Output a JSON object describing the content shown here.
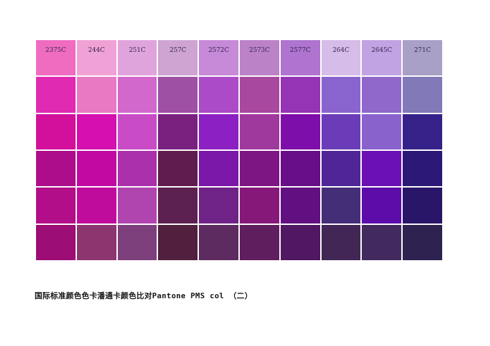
{
  "page": {
    "background_color": "#ffffff"
  },
  "caption": {
    "text": "国际标准颜色色卡潘通卡颜色比对Pantone PMS col （二）",
    "color": "#151515"
  },
  "chart_data": {
    "type": "heatmap",
    "title": "国际标准颜色色卡潘通卡颜色比对Pantone PMS col （二）",
    "columns": [
      "2375C",
      "244C",
      "251C",
      "257C",
      "2572C",
      "2573C",
      "2577C",
      "264C",
      "2645C",
      "271C"
    ],
    "rows": 6,
    "legend_position": "none",
    "grid_line_color": "#ffffff",
    "swatch_label_color": "#33234e",
    "cell_colors": [
      [
        "#ef6cc0",
        "#f0a2d6",
        "#e0a4dc",
        "#cfa4d2",
        "#c68ad8",
        "#bb82c8",
        "#ae74cf",
        "#d6bce8",
        "#c1a2e2",
        "#a8a0c6"
      ],
      [
        "#e02ab2",
        "#e87ac4",
        "#d268cc",
        "#9e50a4",
        "#ab4bc8",
        "#a8489e",
        "#9634b6",
        "#8a64ce",
        "#9067cb",
        "#8279b9"
      ],
      [
        "#d2109c",
        "#d60fb0",
        "#c94cc6",
        "#7a2180",
        "#8c20c2",
        "#a0399e",
        "#7e0eaa",
        "#6a3cb8",
        "#8a62cc",
        "#362189"
      ],
      [
        "#ad0d8a",
        "#c20aa2",
        "#ab30ac",
        "#601c4e",
        "#7b17a8",
        "#7d1682",
        "#670e88",
        "#502597",
        "#6a10b5",
        "#2b1877"
      ],
      [
        "#b20e89",
        "#c00c9c",
        "#b145af",
        "#5c2150",
        "#702386",
        "#851878",
        "#601080",
        "#452e78",
        "#5d0caa",
        "#2a1668"
      ],
      [
        "#9c0d75",
        "#8c356f",
        "#7d407d",
        "#52203f",
        "#5d2b5f",
        "#5f1e5d",
        "#501762",
        "#422655",
        "#432a5e",
        "#2e2250"
      ]
    ]
  }
}
